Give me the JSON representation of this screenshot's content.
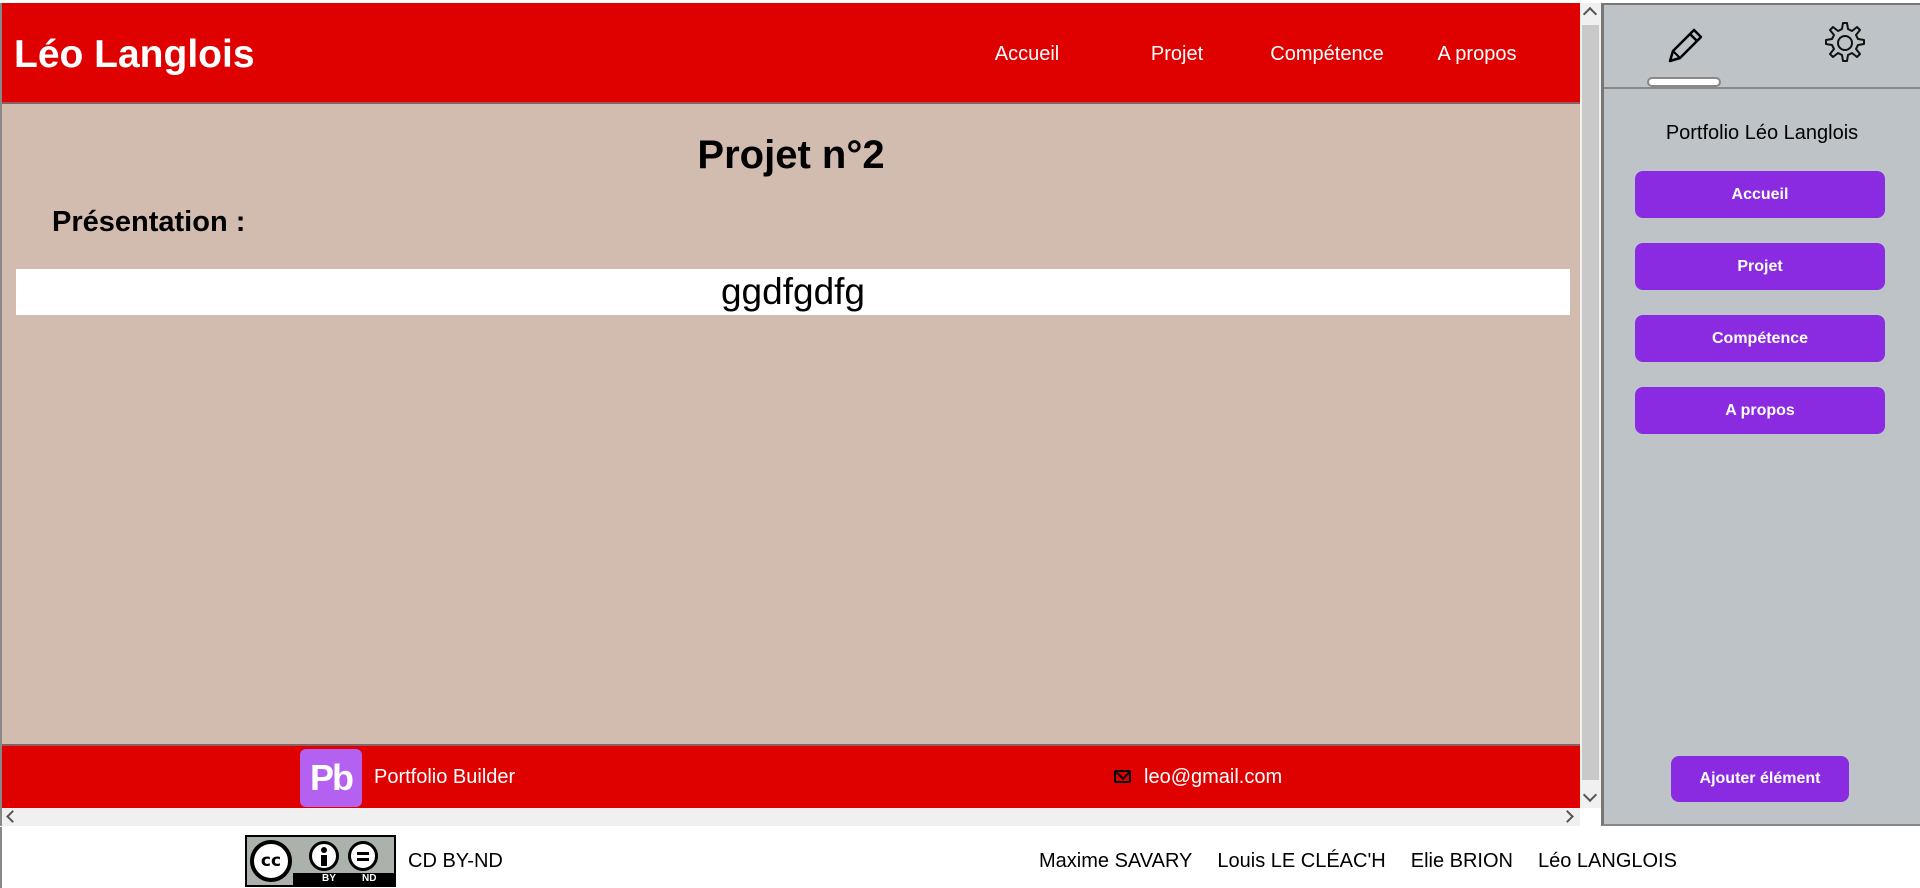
{
  "site": {
    "title": "Léo Langlois",
    "nav": [
      "Accueil",
      "Projet",
      "Compétence",
      "A propos"
    ],
    "colors": {
      "header": "#df0000",
      "background": "#d2bcb0",
      "accent": "#8a2be2"
    }
  },
  "main": {
    "title": "Projet n°2",
    "presentation_label": "Présentation :",
    "presentation_text": "ggdfgdfg"
  },
  "footer": {
    "logo_text": "Pb",
    "brand": "Portfolio Builder",
    "email": "leo@gmail.com",
    "icons": [
      "mail-icon"
    ]
  },
  "panel": {
    "icons": [
      "pencil-icon",
      "gear-icon"
    ],
    "heading": "Portfolio Léo Langlois",
    "buttons": [
      "Accueil",
      "Projet",
      "Compétence",
      "A propos"
    ],
    "add_button": "Ajouter élément"
  },
  "bottom": {
    "license_badge": {
      "cc": "cc",
      "by": "BY",
      "nd": "ND"
    },
    "license_text": "CD BY-ND",
    "authors": [
      "Maxime SAVARY",
      "Louis LE CLÉAC'H",
      "Elie BRION",
      "Léo LANGLOIS"
    ]
  }
}
